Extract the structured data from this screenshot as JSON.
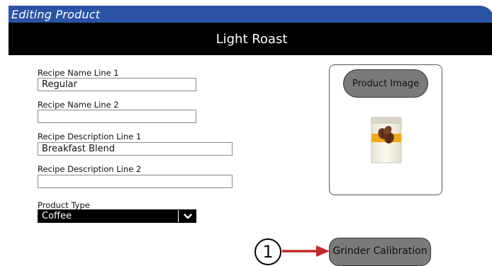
{
  "window": {
    "title": "Editing Product"
  },
  "product": {
    "name": "Light Roast"
  },
  "form": {
    "recipe_name_line1": {
      "label": "Recipe Name Line 1",
      "value": "Regular"
    },
    "recipe_name_line2": {
      "label": "Recipe Name Line 2",
      "value": ""
    },
    "recipe_desc_line1": {
      "label": "Recipe Description Line 1",
      "value": "Breakfast Blend"
    },
    "recipe_desc_line2": {
      "label": "Recipe Description Line 2",
      "value": ""
    },
    "product_type": {
      "label": "Product Type",
      "value": "Coffee"
    }
  },
  "image_panel": {
    "button_label": "Product Image",
    "image_icon": "coffee-package-icon"
  },
  "callout": {
    "number": "1"
  },
  "grinder": {
    "button_label": "Grinder Calibration"
  },
  "colors": {
    "title_bar": "#2a53a6",
    "header_bar": "#000000",
    "button_gray": "#7a7a7a",
    "arrow_red": "#c62828",
    "package_band": "#f0a81c"
  }
}
